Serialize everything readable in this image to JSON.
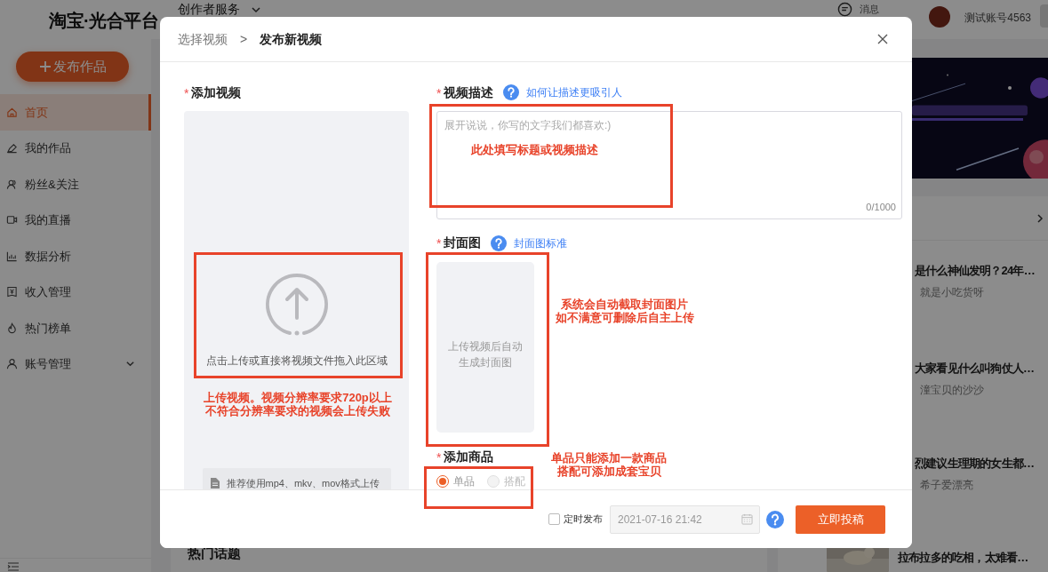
{
  "header": {
    "logo": "淘宝·光合平台",
    "service_menu": "创作者服务",
    "messages": "消息",
    "account": "测试账号4563"
  },
  "sidebar": {
    "publish_button": "发布作品",
    "items": [
      {
        "label": "首页",
        "kind": "link",
        "selected": true
      },
      {
        "label": "我的作品",
        "kind": "link",
        "selected": false
      },
      {
        "label": "粉丝&关注",
        "kind": "link",
        "selected": false
      },
      {
        "label": "我的直播",
        "kind": "link",
        "selected": false
      },
      {
        "label": "数据分析",
        "kind": "link",
        "selected": false
      },
      {
        "label": "收入管理",
        "kind": "link",
        "selected": false
      },
      {
        "label": "热门榜单",
        "kind": "link",
        "selected": false
      },
      {
        "label": "账号管理",
        "kind": "group",
        "selected": false,
        "expanded": false
      }
    ]
  },
  "main": {
    "section_title": "热门话题"
  },
  "feed": {
    "items": [
      {
        "kind": "text",
        "title": "是什么神仙发明？24年…",
        "author": "就是小吃货呀"
      },
      {
        "kind": "text",
        "title": "大家看见什么叫狗仗人…",
        "author": "潼宝贝的沙沙"
      },
      {
        "kind": "text",
        "title": "烈建议生理期的女生都…",
        "author": "希子爱漂亮"
      },
      {
        "kind": "thumb",
        "title": "拉布拉多的吃相，太难看…"
      }
    ]
  },
  "dialog": {
    "breadcrumb": [
      {
        "label": "选择视频",
        "selected": false
      },
      {
        "label": "发布新视频",
        "selected": true
      }
    ],
    "separator": ">",
    "video": {
      "required_mark": "*",
      "label": "添加视频",
      "upload_hint": "点击上传或直接将视频文件拖入此区域",
      "format_hint": "推荐使用mp4、mkv、mov格式上传"
    },
    "description": {
      "required_mark": "*",
      "label": "视频描述",
      "help_link": "如何让描述更吸引人",
      "placeholder": "展开说说，你写的文字我们都喜欢:)",
      "counter": "0/1000"
    },
    "cover": {
      "required_mark": "*",
      "label": "封面图",
      "help_link": "封面图标准",
      "placeholder_lines": [
        "上传视频后自动",
        "生成封面图"
      ]
    },
    "product": {
      "required_mark": "*",
      "label": "添加商品",
      "options": [
        {
          "label": "单品",
          "selected": true,
          "disabled": false
        },
        {
          "label": "搭配",
          "selected": false,
          "disabled": true
        }
      ]
    },
    "footer": {
      "schedule": {
        "label": "定时发布",
        "checked": false
      },
      "datetime": {
        "value": "2021-07-16 21:42",
        "disabled": true
      },
      "submit": "立即投稿"
    }
  },
  "annotations": [
    {
      "lines": [
        "上传视频。视频分辨率要求720p以上",
        "不符合分辨率要求的视频会上传失败"
      ]
    },
    {
      "lines": [
        "此处填写标题或视频描述"
      ]
    },
    {
      "lines": [
        "系统会自动截取封面图片",
        "如不满意可删除后自主上传"
      ]
    },
    {
      "lines": [
        "单品只能添加一款商品",
        "搭配可添加成套宝贝"
      ]
    }
  ]
}
